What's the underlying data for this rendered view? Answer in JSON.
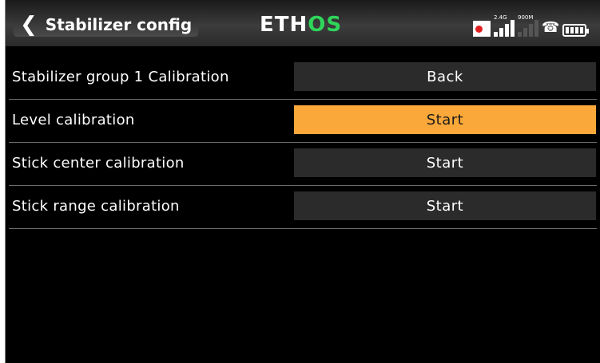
{
  "header": {
    "title": "Stabilizer config",
    "logo_main": "ETH",
    "logo_accent": "OS",
    "rf_24_label": "2.4G",
    "rf_900_label": "900M"
  },
  "rows": [
    {
      "label": "Stabilizer group 1 Calibration",
      "button": "Back",
      "active": false
    },
    {
      "label": "Level calibration",
      "button": "Start",
      "active": true
    },
    {
      "label": "Stick center calibration",
      "button": "Start",
      "active": false
    },
    {
      "label": "Stick range calibration",
      "button": "Start",
      "active": false
    }
  ],
  "colors": {
    "accent": "#fba83a",
    "logo_accent": "#2fd65a",
    "button_bg": "#2b2b2b",
    "background": "#000000"
  }
}
